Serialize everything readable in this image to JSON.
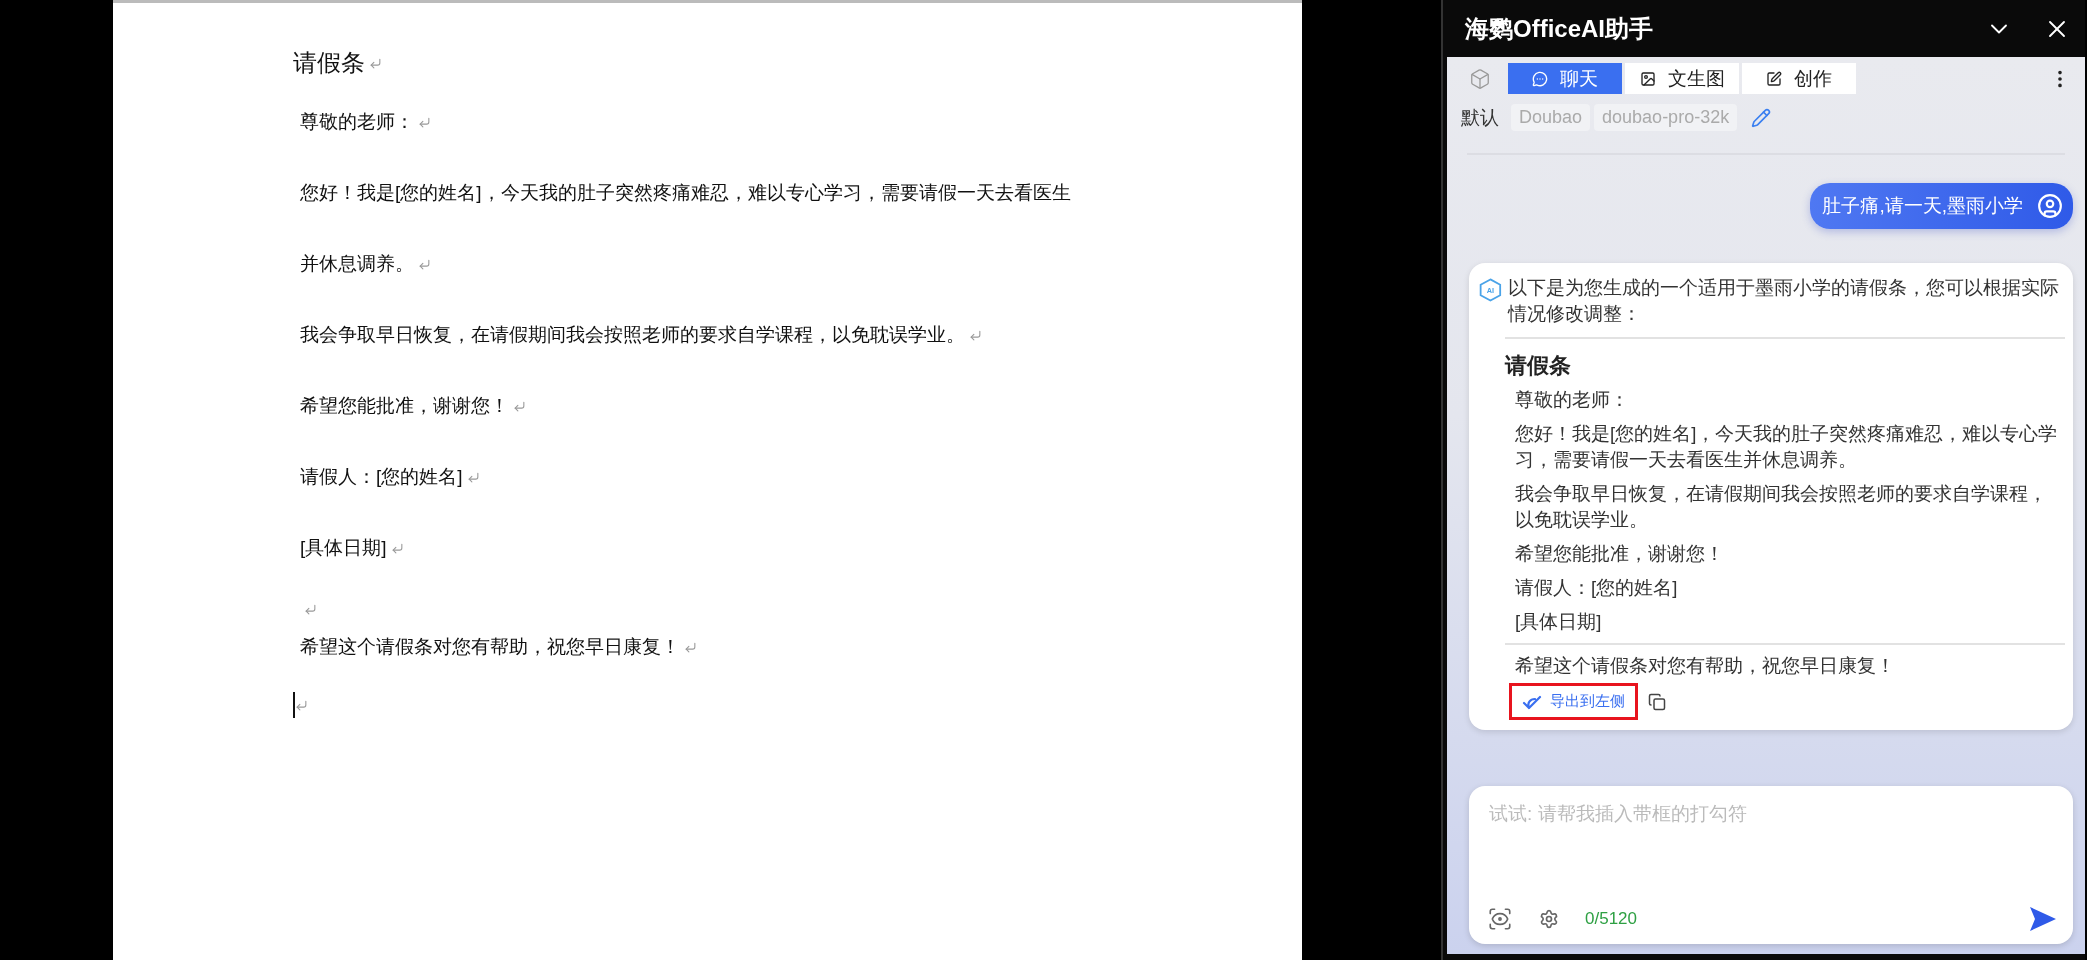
{
  "document": {
    "title": "请假条",
    "paragraphs": [
      {
        "kind": "text",
        "lines": [
          "尊敬的老师："
        ]
      },
      {
        "kind": "text",
        "lines": [
          "您好！我是[您的姓名]，今天我的肚子突然疼痛难忍，难以专心学习，需要请假一天去看医生",
          "并休息调养。"
        ]
      },
      {
        "kind": "text",
        "lines": [
          "我会争取早日恢复，在请假期间我会按照老师的要求自学课程，以免耽误学业。"
        ]
      },
      {
        "kind": "text",
        "lines": [
          "希望您能批准，谢谢您！"
        ]
      },
      {
        "kind": "text",
        "lines": [
          "请假人：[您的姓名]"
        ]
      },
      {
        "kind": "text",
        "lines": [
          "[具体日期]"
        ]
      },
      {
        "kind": "blank"
      },
      {
        "kind": "text",
        "lines": [
          "希望这个请假条对您有帮助，祝您早日康复！"
        ]
      },
      {
        "kind": "cursor"
      }
    ]
  },
  "assistant": {
    "title": "海鹦OfficeAI助手",
    "tabs": [
      {
        "kind": "chat",
        "label": "聊天",
        "selected": true
      },
      {
        "kind": "image",
        "label": "文生图",
        "selected": false
      },
      {
        "kind": "edit",
        "label": "创作",
        "selected": false
      }
    ],
    "model_row": {
      "label": "默认",
      "chips": [
        "Doubao",
        "doubao-pro-32k"
      ]
    },
    "messages": [
      {
        "kind": "user",
        "text": "肚子痛,请一天,墨雨小学"
      },
      {
        "kind": "assistant",
        "badge": "AI",
        "intro": "以下是为您生成的一个适用于墨雨小学的请假条，您可以根据实际情况修改调整：",
        "heading": "请假条",
        "lines": [
          "尊敬的老师：",
          "您好！我是[您的姓名]，今天我的肚子突然疼痛难忍，难以专心学习，需要请假一天去看医生并休息调养。",
          "我会争取早日恢复，在请假期间我会按照老师的要求自学课程，以免耽误学业。",
          "希望您能批准，谢谢您！",
          "请假人：[您的姓名]",
          "[具体日期]"
        ],
        "closing": "希望这个请假条对您有帮助，祝您早日康复！",
        "export_button": {
          "label": "导出到左侧",
          "highlighted": true
        }
      }
    ],
    "input": {
      "placeholder": "试试: 请帮我插入带框的打勾符",
      "counter": "0/5120"
    }
  }
}
